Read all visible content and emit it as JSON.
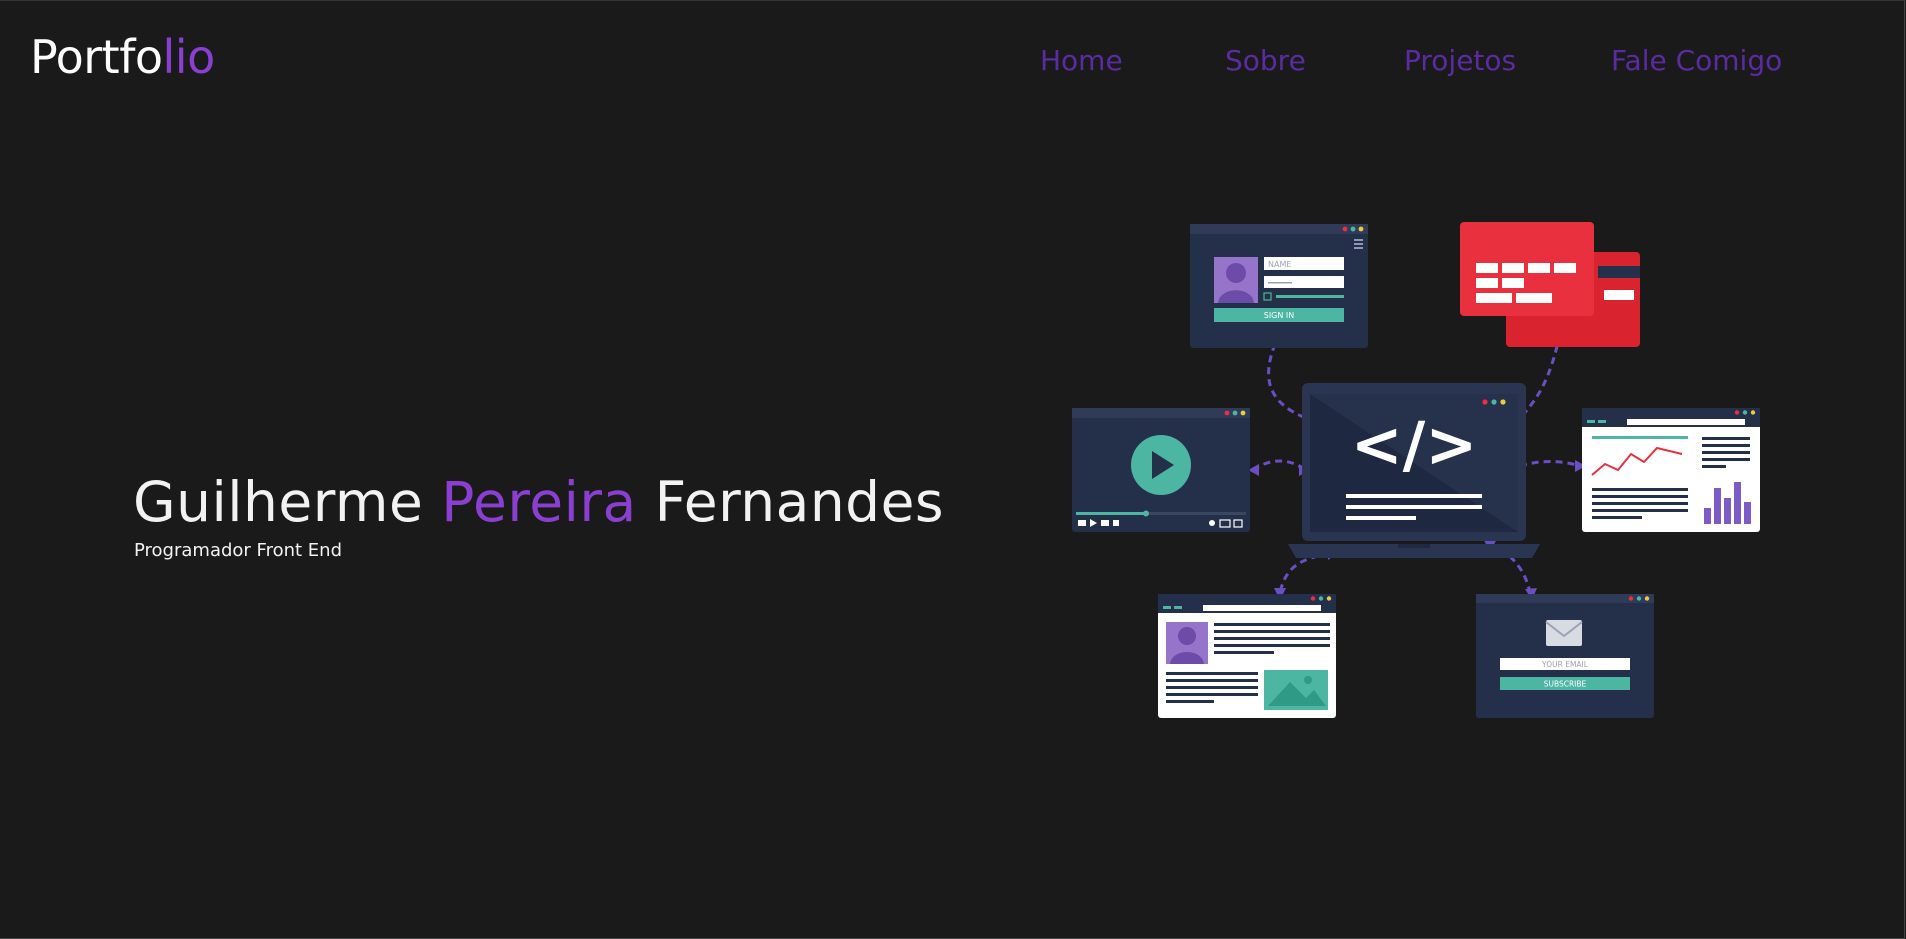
{
  "header": {
    "logo_main": "Portfo",
    "logo_accent": "lio",
    "nav": [
      "Home",
      "Sobre",
      "Projetos",
      "Fale Comigo"
    ]
  },
  "hero": {
    "name_first": "Guilherme ",
    "name_middle": "Pereira",
    "name_last": " Fernandes",
    "subtitle": "Programador Front End"
  },
  "illustration": {
    "login_name_placeholder": "NAME",
    "login_button": "SIGN IN",
    "email_placeholder": "YOUR EMAIL",
    "subscribe_button": "SUBSCRIBE",
    "code_symbol": "</>"
  },
  "colors": {
    "background": "#1a1a1b",
    "accent": "#8a3fd1",
    "nav": "#5b2b9f",
    "panel": "#243049",
    "teal": "#4cb6a2",
    "red": "#e8303f"
  }
}
